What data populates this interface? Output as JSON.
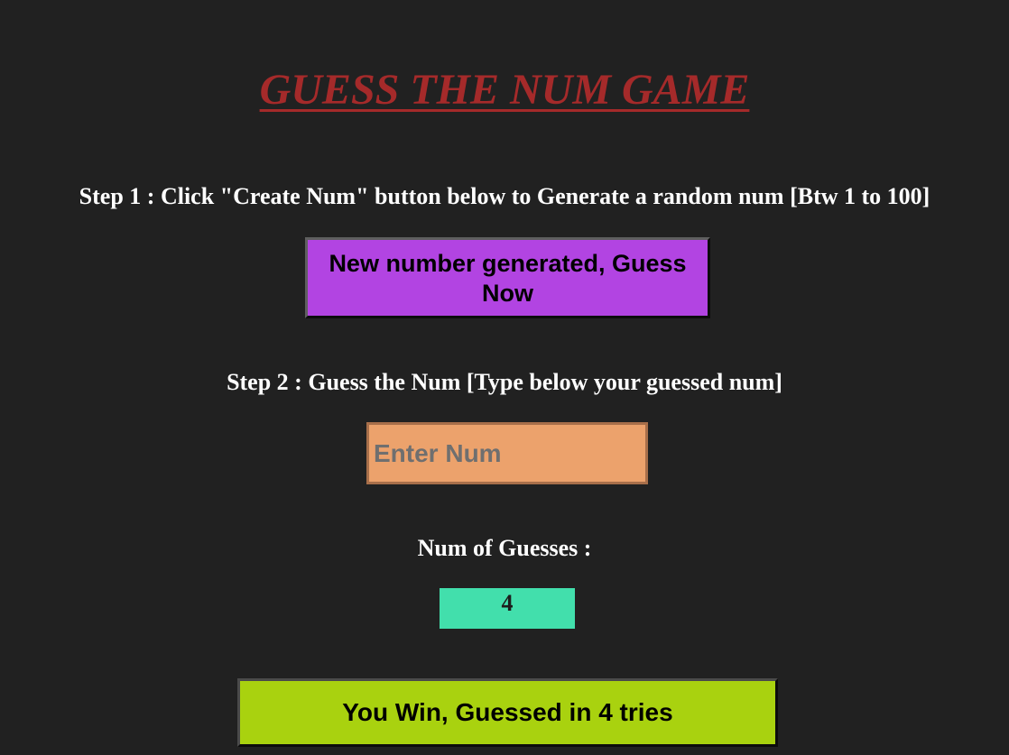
{
  "header": {
    "title": "GUESS THE NUM GAME"
  },
  "step1": {
    "instruction": "Step 1 : Click \"Create Num\" button below to Generate a random num [Btw 1 to 100]",
    "create_button_label": "New number generated, Guess Now"
  },
  "step2": {
    "instruction": "Step 2 : Guess the Num [Type below your guessed num]",
    "input_placeholder": "Enter Num",
    "input_value": ""
  },
  "guesses": {
    "label": "Num of Guesses :",
    "count": "4"
  },
  "result": {
    "label": "You Win, Guessed in 4 tries"
  },
  "colors": {
    "background": "#212121",
    "title": "#a52a2a",
    "create_button": "#b244e2",
    "input_background": "#eca26c",
    "count_background": "#42dfac",
    "result_button": "#a9d20f"
  }
}
